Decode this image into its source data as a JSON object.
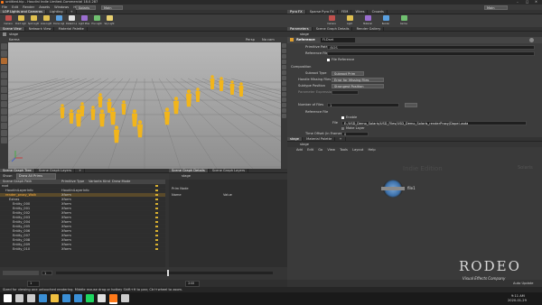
{
  "title_bar": {
    "title": "untitled.hip - Houdini Indie Limited-Commercial 18.0.287",
    "controls": [
      "–",
      "□",
      "✕"
    ]
  },
  "main_menu": {
    "left": [
      "File",
      "Edit",
      "Render",
      "Assets",
      "Windows",
      "Help"
    ],
    "center_selector": "Solaris",
    "center_selector_2": "Main",
    "right_selector": "Main"
  },
  "shelf": {
    "tabs": [
      "LOP Lights and Cameras",
      "Lighting",
      "+"
    ],
    "tools": [
      {
        "label": "Camera",
        "color": "#c0504d"
      },
      {
        "label": "Point Light",
        "color": "#e0c050"
      },
      {
        "label": "Spot Light",
        "color": "#e0c050"
      },
      {
        "label": "Area Light",
        "color": "#e0c050"
      },
      {
        "label": "Dome Light",
        "color": "#5aa0e0"
      },
      {
        "label": "Distant Light",
        "color": "#e0e0e0"
      },
      {
        "label": "Light Mixer",
        "color": "#9b6ed0"
      },
      {
        "label": "Env Light",
        "color": "#70c070"
      },
      {
        "label": "Sky Light",
        "color": "#e8d070"
      }
    ],
    "right_tabs": [
      "Pyro FX",
      "Sparse Pyro FX",
      "FEM",
      "Wires",
      "Crowds"
    ],
    "right_tools": [
      "Camera",
      "Light",
      "Material",
      "Render",
      "Karma"
    ]
  },
  "viewport": {
    "tabs": [
      "Scene View",
      "Network View",
      "Material Palette"
    ],
    "path": "stage",
    "renderer_label": "Karma",
    "persp_label": "Persp",
    "cam_label": "No cam"
  },
  "parameters": {
    "tabs": [
      "Parameters",
      "Scene Graph Details",
      "Render Gallery"
    ],
    "path": "stage",
    "node_type": "Reference",
    "node_name": "FLDset",
    "rows": [
      {
        "label": "Primitive Path",
        "value": "/$OS"
      },
      {
        "label": "Reference File",
        "value": ""
      },
      {
        "label": "Reference Type",
        "value": "File Reference"
      },
      {
        "label": "Composition",
        "value": ""
      },
      {
        "label": "Subroot Type",
        "value": "Subroot Prim"
      },
      {
        "label": "Handle Missing Files",
        "value": "Error for Missing Files"
      },
      {
        "label": "Subtype Position",
        "value": "Strongest Position"
      },
      {
        "label": "Parameter Expression",
        "value": ""
      },
      {
        "label": "Number of Files",
        "value": "1"
      },
      {
        "label": "Reference File",
        "value": ""
      },
      {
        "label": "File",
        "value": "E:/USD_Demo_Solaris/USD_Files/USD_Demo_Solaris_renderProxy/Dopel.usda"
      },
      {
        "label": "Time Offset (in Frames)",
        "value": "0"
      },
      {
        "label": "Time Scale",
        "value": "1"
      }
    ],
    "checkboxes": [
      "Enable",
      "Make Layer"
    ]
  },
  "scene_graph": {
    "tabs": [
      "Scene Graph Tree",
      "Scene Graph Layers",
      "+"
    ],
    "filter_label": "Show:",
    "filter_value": "Draw All Prims",
    "columns": [
      "Scene Graph Path",
      "Primitive Type",
      "Variants",
      "Kind",
      "Draw Mode"
    ],
    "rows": [
      {
        "path": "root",
        "type": "",
        "variants": "",
        "kind": "",
        "draw": ""
      },
      {
        "path": "HoudiniLayerInfo",
        "type": "HoudiniLayerInfo",
        "variants": "",
        "kind": "",
        "draw": ""
      },
      {
        "path": "render_proxy_Walk",
        "type": "Xform",
        "variants": "",
        "kind": "",
        "draw": ""
      },
      {
        "path": "Extras",
        "type": "Xform",
        "variants": "",
        "kind": "",
        "draw": ""
      },
      {
        "path": "Entity_000",
        "type": "Xform",
        "variants": "",
        "kind": "",
        "draw": ""
      },
      {
        "path": "Entity_001",
        "type": "Xform",
        "variants": "",
        "kind": "",
        "draw": ""
      },
      {
        "path": "Entity_002",
        "type": "Xform",
        "variants": "",
        "kind": "",
        "draw": ""
      },
      {
        "path": "Entity_003",
        "type": "Xform",
        "variants": "",
        "kind": "",
        "draw": ""
      },
      {
        "path": "Entity_004",
        "type": "Xform",
        "variants": "",
        "kind": "",
        "draw": ""
      },
      {
        "path": "Entity_005",
        "type": "Xform",
        "variants": "",
        "kind": "",
        "draw": ""
      },
      {
        "path": "Entity_006",
        "type": "Xform",
        "variants": "",
        "kind": "",
        "draw": ""
      },
      {
        "path": "Entity_007",
        "type": "Xform",
        "variants": "",
        "kind": "",
        "draw": ""
      },
      {
        "path": "Entity_008",
        "type": "Xform",
        "variants": "",
        "kind": "",
        "draw": ""
      },
      {
        "path": "Entity_009",
        "type": "Xform",
        "variants": "",
        "kind": "",
        "draw": ""
      },
      {
        "path": "Entity_010",
        "type": "Xform",
        "variants": "",
        "kind": "",
        "draw": ""
      }
    ]
  },
  "scene_graph_details": {
    "tabs": [
      "Scene Graph Details",
      "Scene Graph Layers"
    ],
    "path": "stage",
    "section": "Prim Node",
    "columns": [
      "Name",
      "Value"
    ]
  },
  "network": {
    "tabs": [
      "stage",
      "Material Palette",
      "+"
    ],
    "path": "stage",
    "menu": [
      "Add",
      "Edit",
      "Go",
      "View",
      "Tools",
      "Layout",
      "Help"
    ],
    "watermark": "Indie Edition",
    "context_label": "Solaris",
    "node_label": "file1"
  },
  "timeline": {
    "frame": "1",
    "start": "1",
    "end": "240"
  },
  "status": {
    "message": "Sized for viewing one untouched rendering. Middle mouse drag or hotkey Shift+H to pan; Ctrl+wheel to zoom.",
    "auto_update": "Auto Update"
  },
  "overlay": {
    "brand": "RODEO",
    "subtitle": "Visual Effects Company"
  },
  "taskbar": {
    "items": [
      {
        "name": "windows-start",
        "color": "#ffffff"
      },
      {
        "name": "search",
        "color": "#cccccc"
      },
      {
        "name": "task-view",
        "color": "#cccccc"
      },
      {
        "name": "edge",
        "color": "#3a8fd6"
      },
      {
        "name": "explorer",
        "color": "#f0c040"
      },
      {
        "name": "store",
        "color": "#3a8fd6"
      },
      {
        "name": "mail",
        "color": "#3a8fd6"
      },
      {
        "name": "spotify",
        "color": "#1ed760"
      },
      {
        "name": "chrome",
        "color": "#e0e0e0"
      },
      {
        "name": "houdini",
        "color": "#ff7a1a"
      },
      {
        "name": "notes",
        "color": "#cccccc"
      }
    ],
    "time": "9:11 AM",
    "date": "2020-01-29"
  }
}
